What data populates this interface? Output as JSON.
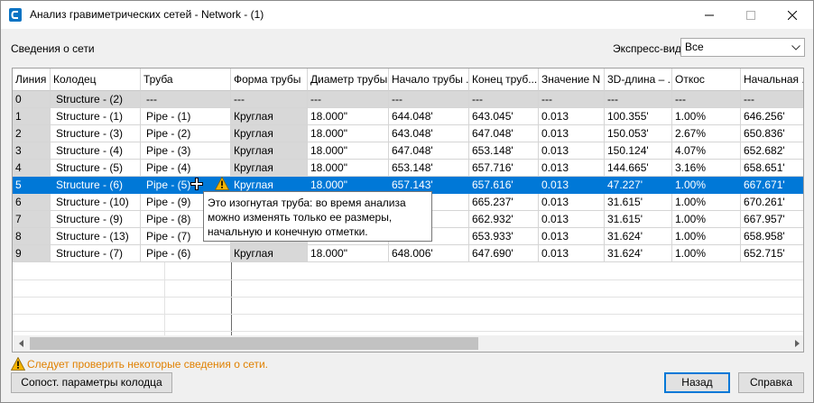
{
  "window": {
    "title": "Анализ гравиметрических сетей - Network - (1)"
  },
  "icons": {
    "app": "civil3d-app-icon",
    "minimize": "minimize-icon",
    "maximize": "maximize-icon",
    "close": "close-icon",
    "warning": "warning-triangle-icon",
    "cursor": "move-cursor-icon"
  },
  "colors": {
    "selection": "#0078d7",
    "warning_text": "#e08000",
    "gray_cell": "#d8d8d8"
  },
  "header": {
    "section_label": "Сведения о сети",
    "express_label": "Экспресс-вид",
    "express_value": "Все"
  },
  "table": {
    "columns": [
      "Линия",
      "Колодец",
      "Труба",
      "Форма трубы",
      "Диаметр трубы",
      "Начало трубы ...",
      "Конец труб...",
      "Значение N",
      "3D-длина – ...",
      "Откос",
      "Начальная ..."
    ],
    "rows": [
      [
        "0",
        "Structure - (2)",
        "---",
        "---",
        "---",
        "---",
        "---",
        "---",
        "---",
        "---",
        "---"
      ],
      [
        "1",
        "Structure - (1)",
        "Pipe - (1)",
        "Круглая",
        "18.000\"",
        "644.048'",
        "643.045'",
        "0.013",
        "100.355'",
        "1.00%",
        "646.256'"
      ],
      [
        "2",
        "Structure - (3)",
        "Pipe - (2)",
        "Круглая",
        "18.000\"",
        "643.048'",
        "647.048'",
        "0.013",
        "150.053'",
        "2.67%",
        "650.836'"
      ],
      [
        "3",
        "Structure - (4)",
        "Pipe - (3)",
        "Круглая",
        "18.000\"",
        "647.048'",
        "653.148'",
        "0.013",
        "150.124'",
        "4.07%",
        "652.682'"
      ],
      [
        "4",
        "Structure - (5)",
        "Pipe - (4)",
        "Круглая",
        "18.000\"",
        "653.148'",
        "657.716'",
        "0.013",
        "144.665'",
        "3.16%",
        "658.651'"
      ],
      [
        "5",
        "Structure - (6)",
        "Pipe - (5)",
        "Круглая",
        "18.000\"",
        "657.143'",
        "657.616'",
        "0.013",
        "47.227'",
        "1.00%",
        "667.671'"
      ],
      [
        "6",
        "Structure - (10)",
        "Pipe - (9)",
        "",
        "",
        "",
        "665.237'",
        "0.013",
        "31.615'",
        "1.00%",
        "670.261'"
      ],
      [
        "7",
        "Structure - (9)",
        "Pipe - (8)",
        "",
        "",
        "",
        "662.932'",
        "0.013",
        "31.615'",
        "1.00%",
        "667.957'"
      ],
      [
        "8",
        "Structure - (13)",
        "Pipe - (7)",
        "",
        "",
        "",
        "653.933'",
        "0.013",
        "31.624'",
        "1.00%",
        "658.958'"
      ],
      [
        "9",
        "Structure - (7)",
        "Pipe - (6)",
        "Круглая",
        "18.000\"",
        "648.006'",
        "647.690'",
        "0.013",
        "31.624'",
        "1.00%",
        "652.715'"
      ]
    ],
    "selected_row": 5
  },
  "tooltip": {
    "line1": "Это изогнутая труба: во время анализа",
    "line2": "можно изменять только ее размеры,",
    "line3": "начальную и конечную отметки."
  },
  "status": {
    "message": "Следует проверить некоторые сведения о сети."
  },
  "buttons": {
    "match_params": "Сопост. параметры колодца",
    "back": "Назад",
    "help": "Справка"
  }
}
